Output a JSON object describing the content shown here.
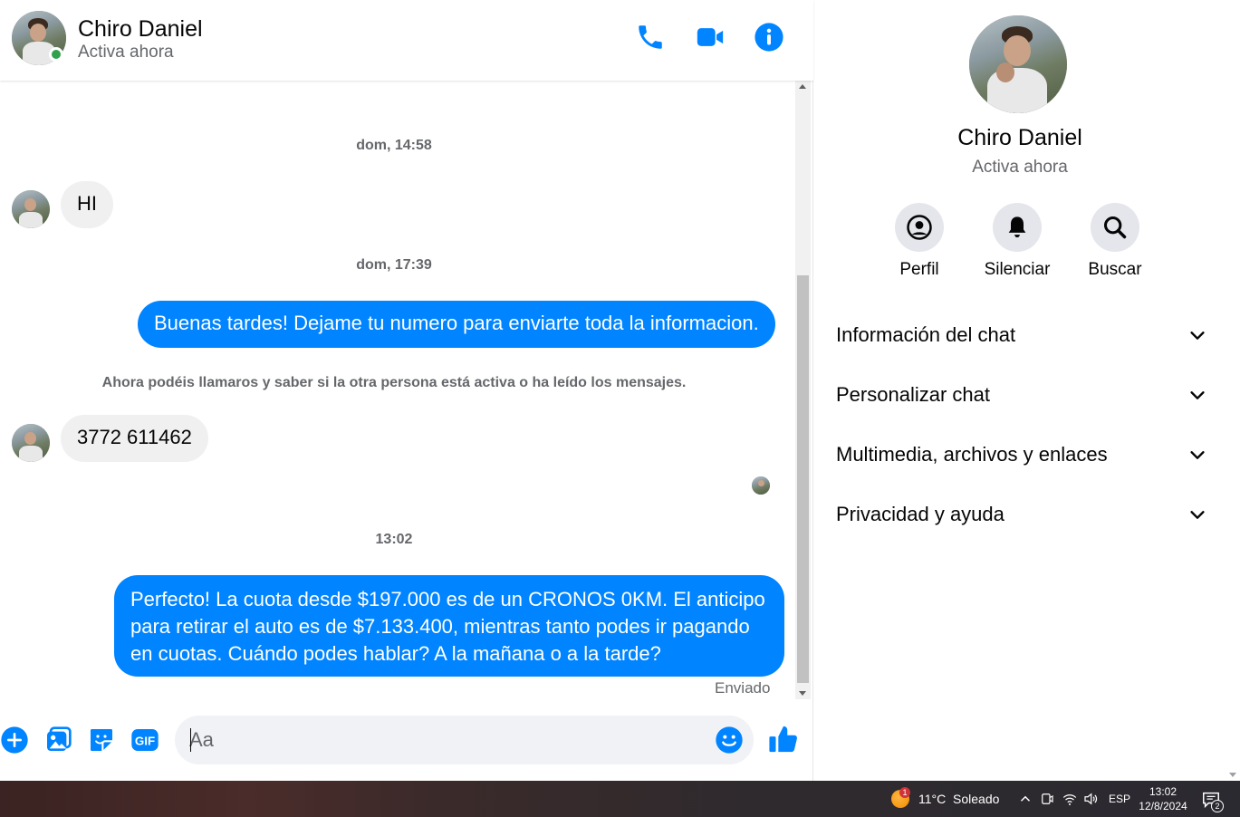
{
  "header": {
    "name": "Chiro Daniel",
    "status": "Activa ahora",
    "icons": [
      "phone-icon",
      "video-camera-icon",
      "info-icon"
    ]
  },
  "messages": {
    "timestamp_1": "dom, 14:58",
    "msg_1": "HI",
    "timestamp_2": "dom, 17:39",
    "msg_2": "Buenas tardes! Dejame tu numero para enviarte toda la informacion.",
    "system_note": "Ahora podéis llamaros y saber si la otra persona está activa o ha leído los mensajes.",
    "msg_3": "3772 611462",
    "timestamp_3": "13:02",
    "msg_4": "Perfecto! La cuota desde $197.000 es de un CRONOS 0KM. El anticipo para retirar el auto es de $7.133.400, mientras tanto podes ir pagando en cuotas. Cuándo podes hablar? A la mañana o a la tarde?",
    "sent_status": "Enviado"
  },
  "composer": {
    "placeholder": "Aa",
    "icons": [
      "plus-icon",
      "image-icon",
      "sticker-icon",
      "gif-icon",
      "emoji-icon",
      "thumbs-up-icon"
    ],
    "gif_label": "GIF"
  },
  "details": {
    "name": "Chiro Daniel",
    "status": "Activa ahora",
    "actions": [
      {
        "label": "Perfil",
        "icon": "profile-icon"
      },
      {
        "label": "Silenciar",
        "icon": "bell-icon"
      },
      {
        "label": "Buscar",
        "icon": "search-icon"
      }
    ],
    "sections": [
      "Información del chat",
      "Personalizar chat",
      "Multimedia, archivos y enlaces",
      "Privacidad y ayuda"
    ]
  },
  "taskbar": {
    "weather": "11°C  Soleado",
    "weather_badge": "1",
    "language": "ESP",
    "time": "13:02",
    "date": "12/8/2024",
    "notifications": "2"
  },
  "colors": {
    "accent": "#0084ff",
    "incoming_bubble": "#f0f0f0",
    "online": "#31a24c",
    "secondary_text": "#65676b"
  }
}
